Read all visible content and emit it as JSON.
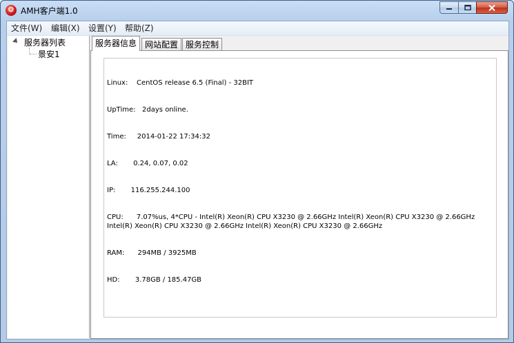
{
  "window": {
    "title": "AMH客户端1.0",
    "icon": "app-logo-icon",
    "controls": {
      "minimize": "minimize-icon",
      "maximize": "maximize-icon",
      "close": "close-icon"
    }
  },
  "menu": [
    "文件(W)",
    "编辑(X)",
    "设置(Y)",
    "帮助(Z)"
  ],
  "tree": {
    "root": "服务器列表",
    "children": [
      "景安1"
    ]
  },
  "tabs": [
    "服务器信息",
    "网站配置",
    "服务控制"
  ],
  "active_tab": "服务器信息",
  "server_info": [
    "Linux:    CentOS release 6.5 (Final) - 32BIT",
    "UpTime:   2days online.",
    "Time:     2014-01-22 17:34:32",
    "LA:       0.24, 0.07, 0.02",
    "IP:       116.255.244.100",
    "CPU:      7.07%us, 4*CPU - Intel(R) Xeon(R) CPU X3230 @ 2.66GHz Intel(R) Xeon(R) CPU X3230 @ 2.66GHz Intel(R) Xeon(R) CPU X3230 @ 2.66GHz Intel(R) Xeon(R) CPU X3230 @ 2.66GHz",
    "RAM:      294MB / 3925MB",
    "HD:       3.78GB / 185.47GB"
  ],
  "colors": {
    "titlebar": "#c9def5",
    "close_button": "#c0311a",
    "panel": "#ffffff"
  }
}
